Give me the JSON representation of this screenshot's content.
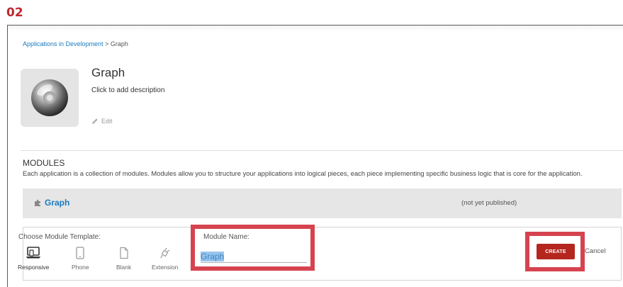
{
  "step_label": "02",
  "breadcrumb": {
    "link": "Applications in Development",
    "separator": ">",
    "current": "Graph"
  },
  "app": {
    "title": "Graph",
    "description": "Click to add description",
    "edit_label": "Edit",
    "icon": "disc-icon"
  },
  "modules": {
    "heading": "MODULES",
    "description": "Each application is a collection of modules. Modules allow you to structure your applications into logical pieces, each piece implementing specific business logic that is core for the application.",
    "items": [
      {
        "name": "Graph",
        "status": "(not yet published)",
        "icon": "puzzle-icon"
      }
    ]
  },
  "create_form": {
    "template_label": "Choose Module Template:",
    "templates": [
      {
        "label": "Responsive",
        "icon": "responsive-icon",
        "selected": true
      },
      {
        "label": "Phone",
        "icon": "phone-icon",
        "selected": false
      },
      {
        "label": "Blank",
        "icon": "blank-page-icon",
        "selected": false
      },
      {
        "label": "Extension",
        "icon": "plug-icon",
        "selected": false
      }
    ],
    "name_label": "Module Name:",
    "name_value": "Graph",
    "create_label": "CREATE",
    "cancel_label": "Cancel"
  },
  "colors": {
    "step_label": "#c0262e",
    "highlight_border": "#d6434f",
    "create_button": "#b5261f",
    "link": "#1a7bbf"
  }
}
